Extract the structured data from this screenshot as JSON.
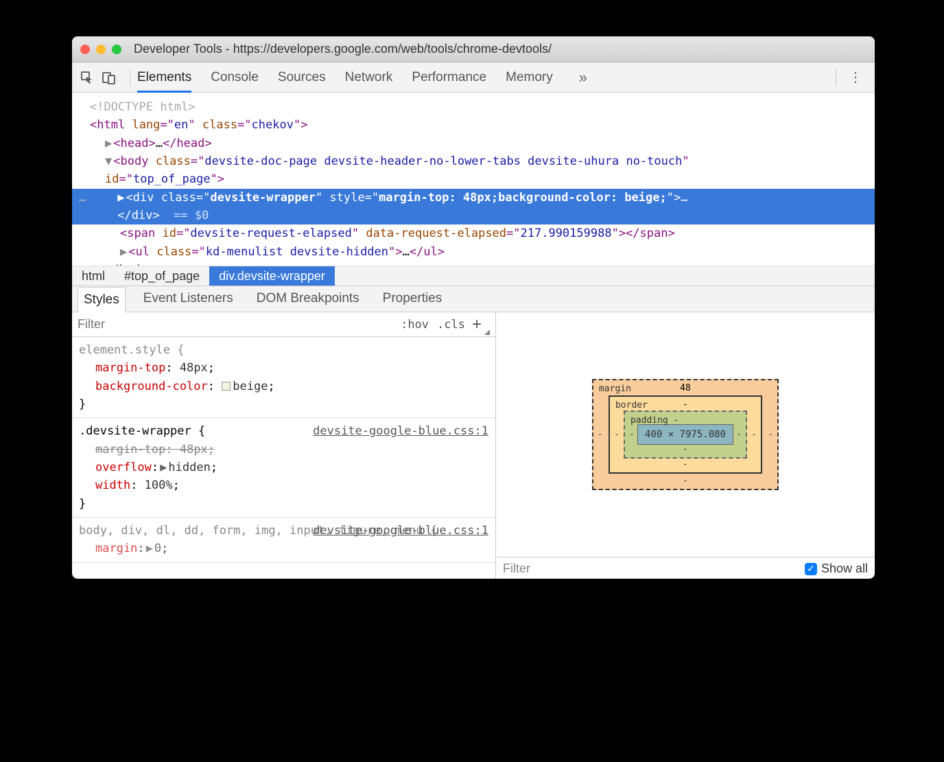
{
  "window": {
    "title": "Developer Tools - https://developers.google.com/web/tools/chrome-devtools/"
  },
  "toolbar": {
    "tabs": [
      "Elements",
      "Console",
      "Sources",
      "Network",
      "Performance",
      "Memory"
    ],
    "active": 0,
    "more": "»"
  },
  "dom": {
    "doctype": "<!DOCTYPE html>",
    "html_open": {
      "tag": "html",
      "attrs": [
        [
          "lang",
          "en"
        ],
        [
          "class",
          "chekov"
        ]
      ]
    },
    "head": {
      "tag": "head"
    },
    "body_open": {
      "tag": "body",
      "attrs": [
        [
          "class",
          "devsite-doc-page devsite-header-no-lower-tabs devsite-uhura no-touch"
        ],
        [
          "id",
          "top_of_page"
        ]
      ]
    },
    "selected": {
      "tag": "div",
      "attrs": [
        [
          "class",
          "devsite-wrapper"
        ],
        [
          "style",
          "margin-top: 48px;background-color: beige;"
        ]
      ],
      "eq": "== $0"
    },
    "span_line": {
      "tag": "span",
      "attrs": [
        [
          "id",
          "devsite-request-elapsed"
        ],
        [
          "data-request-elapsed",
          "217.990159988"
        ]
      ]
    },
    "ul_line": {
      "tag": "ul",
      "attrs": [
        [
          "class",
          "kd-menulist devsite-hidden"
        ]
      ]
    },
    "body_close": "</body>"
  },
  "breadcrumbs": [
    "html",
    "#top_of_page",
    "div.devsite-wrapper"
  ],
  "subtabs": [
    "Styles",
    "Event Listeners",
    "DOM Breakpoints",
    "Properties"
  ],
  "styles": {
    "filter_placeholder": "Filter",
    "hov": ":hov",
    "cls": ".cls",
    "rules": [
      {
        "selector": "element.style {",
        "source": "",
        "props": [
          {
            "name": "margin-top",
            "value": "48px",
            "struck": false
          },
          {
            "name": "background-color",
            "value": "beige",
            "struck": false,
            "swatch": true
          }
        ]
      },
      {
        "selector": ".devsite-wrapper {",
        "source": "devsite-google-blue.css:1",
        "props": [
          {
            "name": "margin-top",
            "value": "48px",
            "struck": true
          },
          {
            "name": "overflow",
            "value": "hidden",
            "struck": false,
            "tri": true
          },
          {
            "name": "width",
            "value": "100%",
            "struck": false
          }
        ]
      },
      {
        "selector": "body, div, dl, dd, form, img, input, figure, menu {",
        "source": "devsite-google-blue.css:1",
        "props": [
          {
            "name": "margin",
            "value": "0",
            "struck": false,
            "tri": true,
            "partial": true
          }
        ]
      }
    ]
  },
  "boxmodel": {
    "margin": {
      "label": "margin",
      "top": "48",
      "right": "-",
      "bottom": "-",
      "left": "-"
    },
    "border": {
      "label": "border",
      "top": "-",
      "right": "-",
      "bottom": "-",
      "left": "-"
    },
    "padding": {
      "label": "padding",
      "top": "-",
      "right": "-",
      "bottom": "-",
      "left": "-"
    },
    "content": "400 × 7975.080"
  },
  "computed": {
    "filter": "Filter",
    "showall": "Show all"
  }
}
